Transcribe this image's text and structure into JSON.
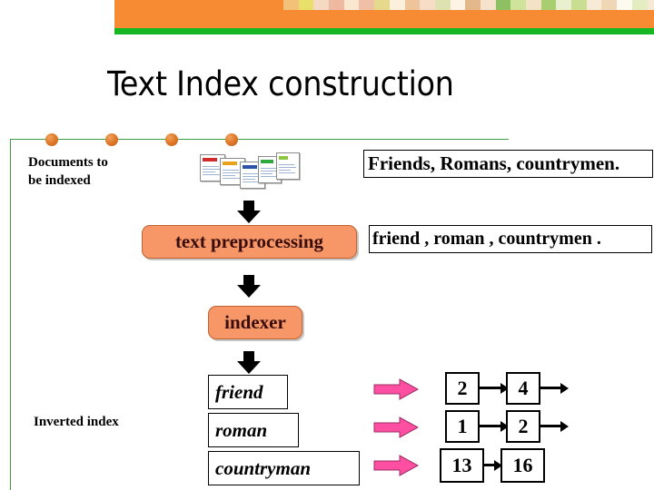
{
  "slide": {
    "title": "Text Index construction",
    "banner": {
      "bar_color": "#F68B33",
      "accent_color": "#17B723"
    },
    "rule_color": "#3F9B3F",
    "bullet_dots": 4
  },
  "flow": {
    "source_label_line1": "Documents to",
    "source_label_line2": "be indexed",
    "raw_text": "Friends, Romans, countrymen.",
    "preprocess_label": "text preprocessing",
    "token_text": "friend , roman , countrymen .",
    "indexer_label": "indexer",
    "inverted_index_label": "Inverted index"
  },
  "dictionary": [
    {
      "term": "friend",
      "postings": [
        "2",
        "4"
      ],
      "open_tail": true
    },
    {
      "term": "roman",
      "postings": [
        "1",
        "2"
      ],
      "open_tail": true
    },
    {
      "term": "countryman",
      "postings": [
        "13",
        "16"
      ],
      "open_tail": false
    }
  ],
  "icons": {
    "down_arrow": "down-block-arrow",
    "right_arrow": "right-block-arrow-pink",
    "documents": "document-stack"
  },
  "colors": {
    "process_fill": "#F79767",
    "posting_arrow": "#FF4FA3",
    "dot_fill": "#E07B2B"
  }
}
